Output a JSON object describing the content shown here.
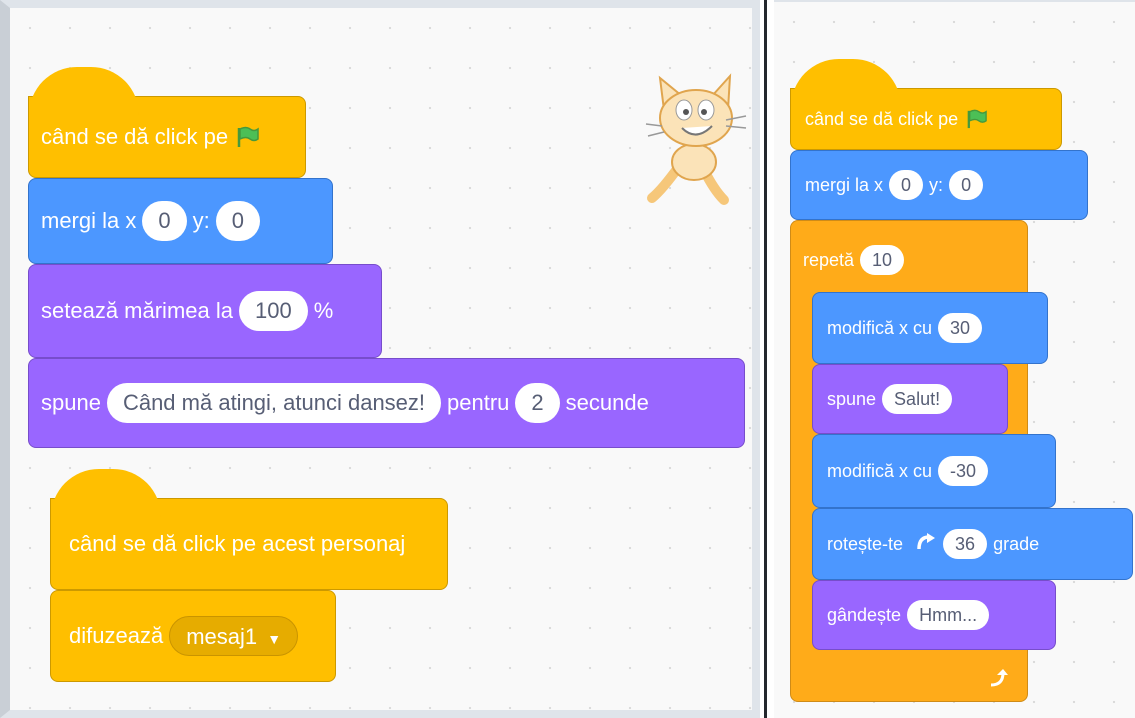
{
  "left": {
    "script1": {
      "hat_label": "când se dă click pe",
      "goto": {
        "label_x": "mergi la x",
        "x": "0",
        "label_y": "y:",
        "y": "0"
      },
      "size": {
        "label": "setează mărimea la",
        "value": "100",
        "unit": "%"
      },
      "say": {
        "label": "spune",
        "message": "Când mă atingi, atunci dansez!",
        "label_for": "pentru",
        "secs": "2",
        "label_secs": "secunde"
      }
    },
    "script2": {
      "hat_label": "când se dă click pe acest personaj",
      "broadcast": {
        "label": "difuzează",
        "message": "mesaj1"
      }
    },
    "sprite_icon": "scratch-cat-icon"
  },
  "right": {
    "hat_label": "când se dă click pe",
    "goto": {
      "label_x": "mergi la x",
      "x": "0",
      "label_y": "y:",
      "y": "0"
    },
    "repeat": {
      "label": "repetă",
      "count": "10"
    },
    "inner": {
      "change1": {
        "label": "modifică x cu",
        "value": "30"
      },
      "say": {
        "label": "spune",
        "message": "Salut!"
      },
      "change2": {
        "label": "modifică x cu",
        "value": "-30"
      },
      "turn": {
        "label": "rotește-te",
        "value": "36",
        "unit": "grade"
      },
      "think": {
        "label": "gândește",
        "message": "Hmm..."
      }
    }
  },
  "colors": {
    "events": "#ffbf00",
    "motion": "#4c97ff",
    "looks": "#9966ff",
    "control": "#ffab19"
  }
}
